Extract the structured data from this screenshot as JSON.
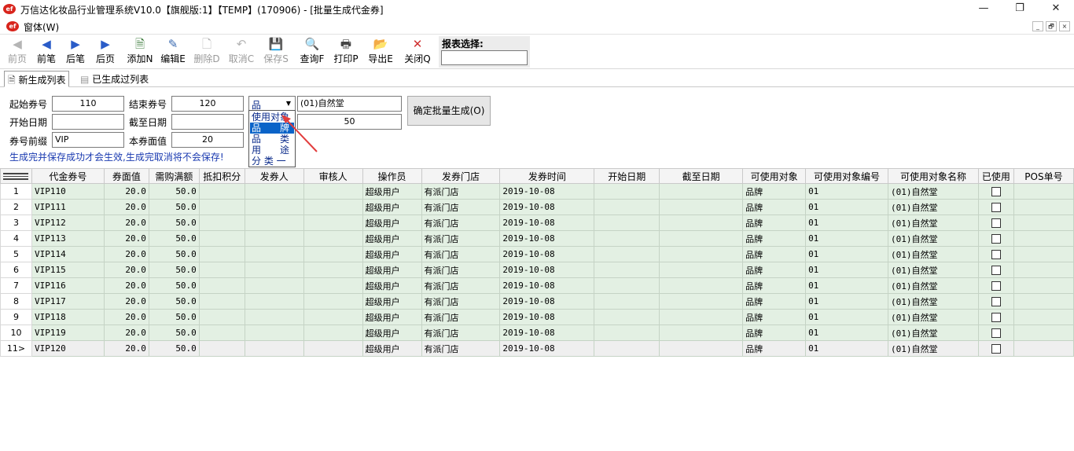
{
  "window": {
    "title": "万信达化妆品行业管理系统V10.0【旗舰版:1】【TEMP】(170906) - [批量生成代金券]",
    "logo": "ef",
    "minimize": "—",
    "maximize": "❐",
    "close": "✕"
  },
  "menu": {
    "label": "窗体(W)",
    "mdi_min": "_",
    "mdi_restore": "🗗",
    "mdi_close": "×"
  },
  "toolbar": [
    {
      "label": "前页",
      "icon": "first-page-icon",
      "glyph": "◀",
      "disabled": true
    },
    {
      "label": "前笔",
      "icon": "prev-record-icon",
      "glyph": "◀",
      "disabled": false
    },
    {
      "label": "后笔",
      "icon": "next-record-icon",
      "glyph": "▶",
      "disabled": false
    },
    {
      "label": "后页",
      "icon": "last-page-icon",
      "glyph": "▶",
      "disabled": false
    },
    {
      "label": "添加N",
      "icon": "add-icon",
      "glyph": "🗎",
      "disabled": false
    },
    {
      "label": "编辑E",
      "icon": "edit-icon",
      "glyph": "✎",
      "disabled": false
    },
    {
      "label": "删除D",
      "icon": "delete-icon",
      "glyph": "🗋",
      "disabled": true
    },
    {
      "label": "取消C",
      "icon": "undo-icon",
      "glyph": "↶",
      "disabled": true
    },
    {
      "label": "保存S",
      "icon": "save-icon",
      "glyph": "💾",
      "disabled": true
    },
    {
      "label": "查询F",
      "icon": "query-icon",
      "glyph": "🔍",
      "disabled": false
    },
    {
      "label": "打印P",
      "icon": "print-icon",
      "glyph": "🖶",
      "disabled": false
    },
    {
      "label": "导出E",
      "icon": "export-icon",
      "glyph": "📂",
      "disabled": false
    },
    {
      "label": "关闭Q",
      "icon": "close-icon",
      "glyph": "✕",
      "disabled": false
    }
  ],
  "report": {
    "label": "报表选择:",
    "value": ""
  },
  "tabs": [
    {
      "label": "新生成列表",
      "active": true
    },
    {
      "label": "已生成过列表",
      "active": false
    }
  ],
  "form": {
    "start_no_label": "起始券号",
    "start_no": "110",
    "end_no_label": "结束券号",
    "end_no": "120",
    "start_date_label": "开始日期",
    "start_date": "",
    "end_date_label": "截至日期",
    "end_date": "",
    "prefix_label": "券号前缀",
    "prefix": "VIP",
    "face_value_label": "本券面值",
    "face_value": "20",
    "target_combo": "品",
    "target_name": "(01)自然堂",
    "min_amount": "50",
    "generate_button": "确定批量生成(O)",
    "hint": "生成完并保存成功才会生效,生成完取消将不会保存!"
  },
  "dropdown": {
    "items": [
      "使用对象",
      "品　　牌",
      "品　　类",
      "用　　途",
      "分 类 一"
    ],
    "selected_index": 1
  },
  "grid": {
    "columns": [
      "代金券号",
      "券面值",
      "需购满额",
      "抵扣积分",
      "发券人",
      "审核人",
      "操作员",
      "发券门店",
      "发券时间",
      "开始日期",
      "截至日期",
      "可使用对象",
      "可使用对象编号",
      "可使用对象名称",
      "已使用",
      "POS单号"
    ],
    "rows": [
      {
        "rn": "1",
        "code": "VIP110",
        "face": "20.0",
        "min": "50.0",
        "points": "",
        "issuer": "",
        "auditor": "",
        "operator": "超级用户",
        "store": "有派门店",
        "issue_time": "2019-10-08",
        "start": "",
        "end": "",
        "target": "品牌",
        "target_no": "01",
        "target_name": "(01)自然堂",
        "pos": ""
      },
      {
        "rn": "2",
        "code": "VIP111",
        "face": "20.0",
        "min": "50.0",
        "points": "",
        "issuer": "",
        "auditor": "",
        "operator": "超级用户",
        "store": "有派门店",
        "issue_time": "2019-10-08",
        "start": "",
        "end": "",
        "target": "品牌",
        "target_no": "01",
        "target_name": "(01)自然堂",
        "pos": ""
      },
      {
        "rn": "3",
        "code": "VIP112",
        "face": "20.0",
        "min": "50.0",
        "points": "",
        "issuer": "",
        "auditor": "",
        "operator": "超级用户",
        "store": "有派门店",
        "issue_time": "2019-10-08",
        "start": "",
        "end": "",
        "target": "品牌",
        "target_no": "01",
        "target_name": "(01)自然堂",
        "pos": ""
      },
      {
        "rn": "4",
        "code": "VIP113",
        "face": "20.0",
        "min": "50.0",
        "points": "",
        "issuer": "",
        "auditor": "",
        "operator": "超级用户",
        "store": "有派门店",
        "issue_time": "2019-10-08",
        "start": "",
        "end": "",
        "target": "品牌",
        "target_no": "01",
        "target_name": "(01)自然堂",
        "pos": ""
      },
      {
        "rn": "5",
        "code": "VIP114",
        "face": "20.0",
        "min": "50.0",
        "points": "",
        "issuer": "",
        "auditor": "",
        "operator": "超级用户",
        "store": "有派门店",
        "issue_time": "2019-10-08",
        "start": "",
        "end": "",
        "target": "品牌",
        "target_no": "01",
        "target_name": "(01)自然堂",
        "pos": ""
      },
      {
        "rn": "6",
        "code": "VIP115",
        "face": "20.0",
        "min": "50.0",
        "points": "",
        "issuer": "",
        "auditor": "",
        "operator": "超级用户",
        "store": "有派门店",
        "issue_time": "2019-10-08",
        "start": "",
        "end": "",
        "target": "品牌",
        "target_no": "01",
        "target_name": "(01)自然堂",
        "pos": ""
      },
      {
        "rn": "7",
        "code": "VIP116",
        "face": "20.0",
        "min": "50.0",
        "points": "",
        "issuer": "",
        "auditor": "",
        "operator": "超级用户",
        "store": "有派门店",
        "issue_time": "2019-10-08",
        "start": "",
        "end": "",
        "target": "品牌",
        "target_no": "01",
        "target_name": "(01)自然堂",
        "pos": ""
      },
      {
        "rn": "8",
        "code": "VIP117",
        "face": "20.0",
        "min": "50.0",
        "points": "",
        "issuer": "",
        "auditor": "",
        "operator": "超级用户",
        "store": "有派门店",
        "issue_time": "2019-10-08",
        "start": "",
        "end": "",
        "target": "品牌",
        "target_no": "01",
        "target_name": "(01)自然堂",
        "pos": ""
      },
      {
        "rn": "9",
        "code": "VIP118",
        "face": "20.0",
        "min": "50.0",
        "points": "",
        "issuer": "",
        "auditor": "",
        "operator": "超级用户",
        "store": "有派门店",
        "issue_time": "2019-10-08",
        "start": "",
        "end": "",
        "target": "品牌",
        "target_no": "01",
        "target_name": "(01)自然堂",
        "pos": ""
      },
      {
        "rn": "10",
        "code": "VIP119",
        "face": "20.0",
        "min": "50.0",
        "points": "",
        "issuer": "",
        "auditor": "",
        "operator": "超级用户",
        "store": "有派门店",
        "issue_time": "2019-10-08",
        "start": "",
        "end": "",
        "target": "品牌",
        "target_no": "01",
        "target_name": "(01)自然堂",
        "pos": ""
      },
      {
        "rn": "11>",
        "code": "VIP120",
        "face": "20.0",
        "min": "50.0",
        "points": "",
        "issuer": "",
        "auditor": "",
        "operator": "超级用户",
        "store": "有派门店",
        "issue_time": "2019-10-08",
        "start": "",
        "end": "",
        "target": "品牌",
        "target_no": "01",
        "target_name": "(01)自然堂",
        "pos": ""
      }
    ],
    "current_row": 10
  },
  "colors": {
    "row_bg": "#e3f0e3",
    "selection": "#0a63c8",
    "hint": "#1a3ab0",
    "arrow": "#e23c3c"
  }
}
